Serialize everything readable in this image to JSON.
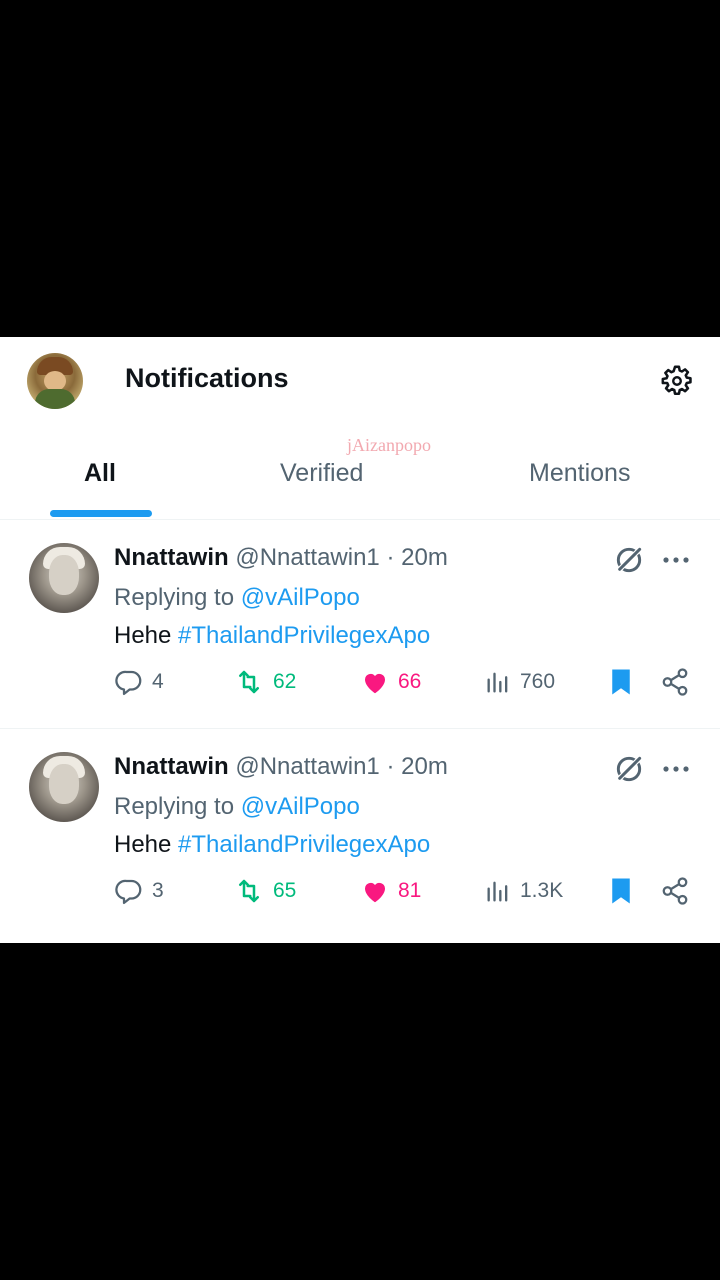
{
  "header": {
    "title": "Notifications",
    "watermark": "jAizanpopo"
  },
  "tabs": [
    {
      "label": "All",
      "active": true
    },
    {
      "label": "Verified",
      "active": false
    },
    {
      "label": "Mentions",
      "active": false
    }
  ],
  "tweets": [
    {
      "display_name": "Nnattawin",
      "handle": "@Nnattawin1",
      "separator": "·",
      "time": "20m",
      "replying_prefix": "Replying to",
      "replying_to": "@vAilPopo",
      "text": "Hehe",
      "hashtag": "#ThailandPrivilegexApo",
      "replies": "4",
      "retweets": "62",
      "likes": "66",
      "views": "760"
    },
    {
      "display_name": "Nnattawin",
      "handle": "@Nnattawin1",
      "separator": "·",
      "time": "20m",
      "replying_prefix": "Replying to",
      "replying_to": "@vAilPopo",
      "text": "Hehe",
      "hashtag": "#ThailandPrivilegexApo",
      "replies": "3",
      "retweets": "65",
      "likes": "81",
      "views": "1.3K"
    }
  ],
  "icons": {
    "settings": "gear-icon",
    "grok": "grok-icon",
    "more": "more-icon",
    "reply": "reply-icon",
    "retweet": "retweet-icon",
    "like": "heart-icon",
    "views": "views-icon",
    "bookmark": "bookmark-icon",
    "share": "share-icon"
  },
  "colors": {
    "accent": "#1d9bf0",
    "retweet": "#00ba7c",
    "like": "#f91880",
    "text": "#0f1419",
    "muted": "#536471",
    "background": "#000000"
  }
}
